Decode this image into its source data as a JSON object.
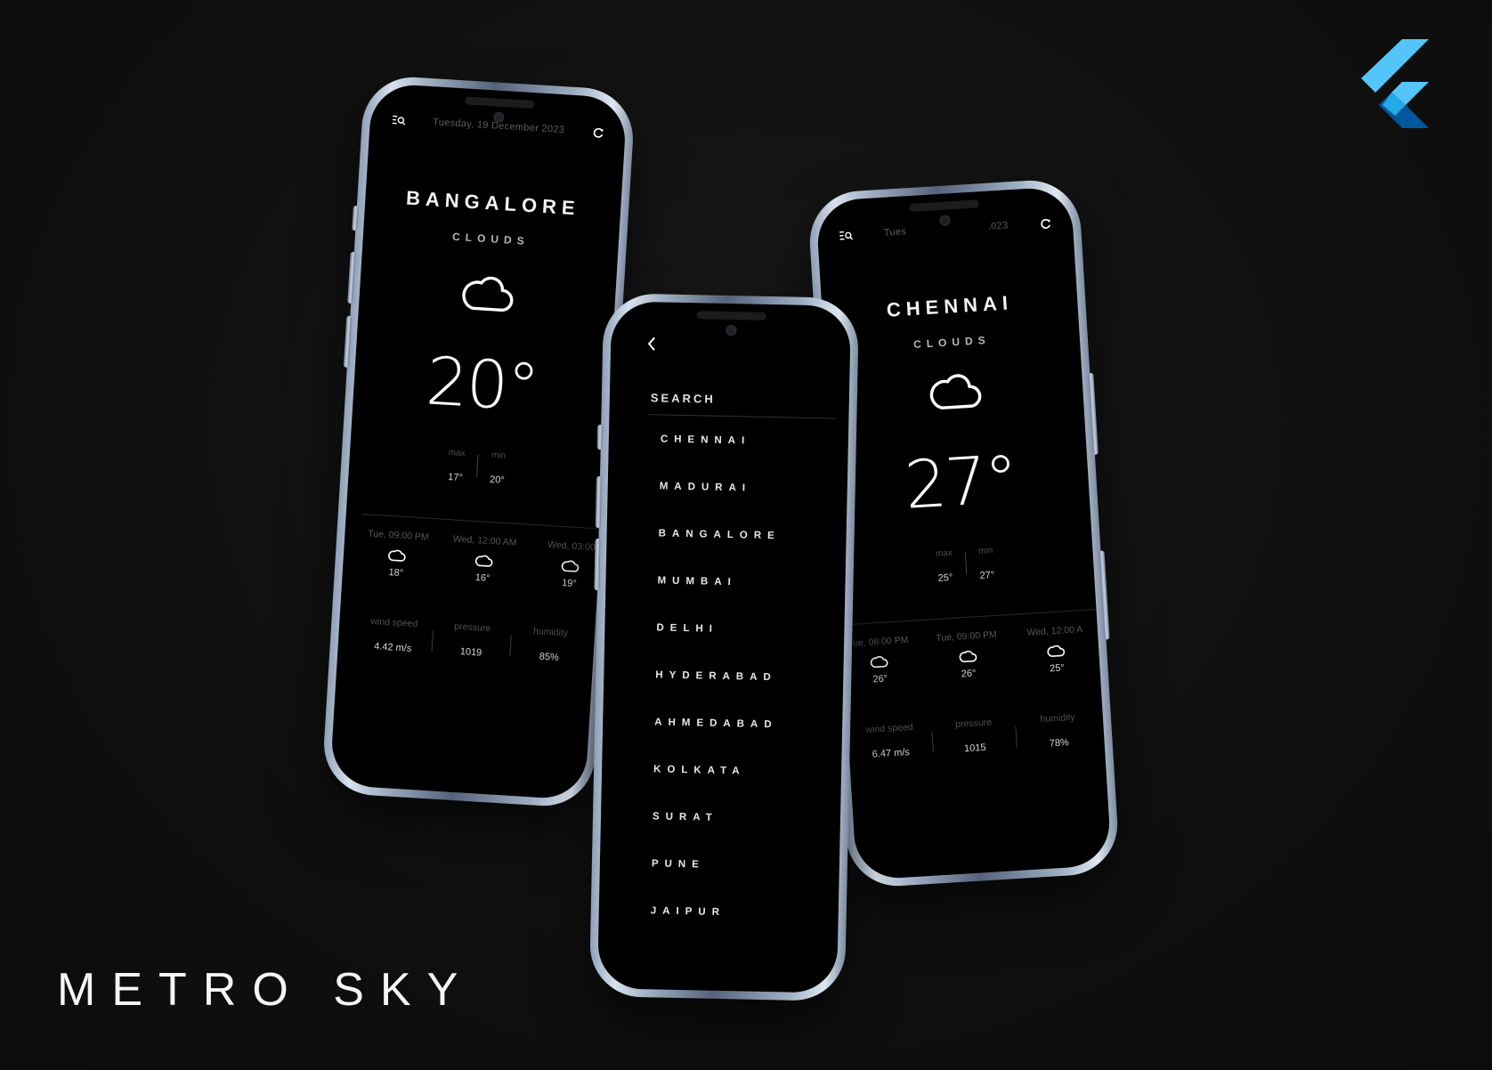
{
  "brand": {
    "title": "METRO SKY"
  },
  "colors": {
    "background": "#121212",
    "screen": "#000000",
    "frame": "#a4b3c6",
    "logo_light": "#54c5f8",
    "logo_dark": "#01579b"
  },
  "icons": {
    "menu_search": "search-menu-icon",
    "refresh": "refresh-icon",
    "back": "chevron-left-icon",
    "weather": "cloud-icon",
    "logo": "flutter-logo-icon"
  },
  "left_phone": {
    "date": "Tuesday, 19 December 2023",
    "city": "BANGALORE",
    "condition": "CLOUDS",
    "temperature": "20°",
    "max_label": "max",
    "min_label": "min",
    "max": "17°",
    "min": "20°",
    "forecast": [
      {
        "time": "Tue, 09:00 PM",
        "temp": "18°"
      },
      {
        "time": "Wed, 12:00 AM",
        "temp": "16°"
      },
      {
        "time": "Wed, 03:00",
        "temp": "19°"
      }
    ],
    "stats": [
      {
        "label": "wind speed",
        "value": "4.42 m/s"
      },
      {
        "label": "pressure",
        "value": "1019"
      },
      {
        "label": "humidity",
        "value": "85%"
      }
    ]
  },
  "right_phone": {
    "date": "Tues",
    "date_tail": ".023",
    "city": "CHENNAI",
    "condition": "CLOUDS",
    "temperature": "27°",
    "max_label": "max",
    "min_label": "min",
    "max": "25°",
    "min": "27°",
    "forecast": [
      {
        "time": "Tue, 06:00 PM",
        "temp": "26°"
      },
      {
        "time": "Tue, 09:00 PM",
        "temp": "26°"
      },
      {
        "time": "Wed, 12:00 A",
        "temp": "25°"
      }
    ],
    "stats": [
      {
        "label": "wind speed",
        "value": "6.47 m/s"
      },
      {
        "label": "pressure",
        "value": "1015"
      },
      {
        "label": "humidity",
        "value": "78%"
      }
    ]
  },
  "search_phone": {
    "label": "SEARCH",
    "cities": [
      "CHENNAI",
      "MADURAI",
      "BANGALORE",
      "MUMBAI",
      "DELHI",
      "HYDERABAD",
      "AHMEDABAD",
      "KOLKATA",
      "SURAT",
      "PUNE",
      "JAIPUR"
    ]
  }
}
